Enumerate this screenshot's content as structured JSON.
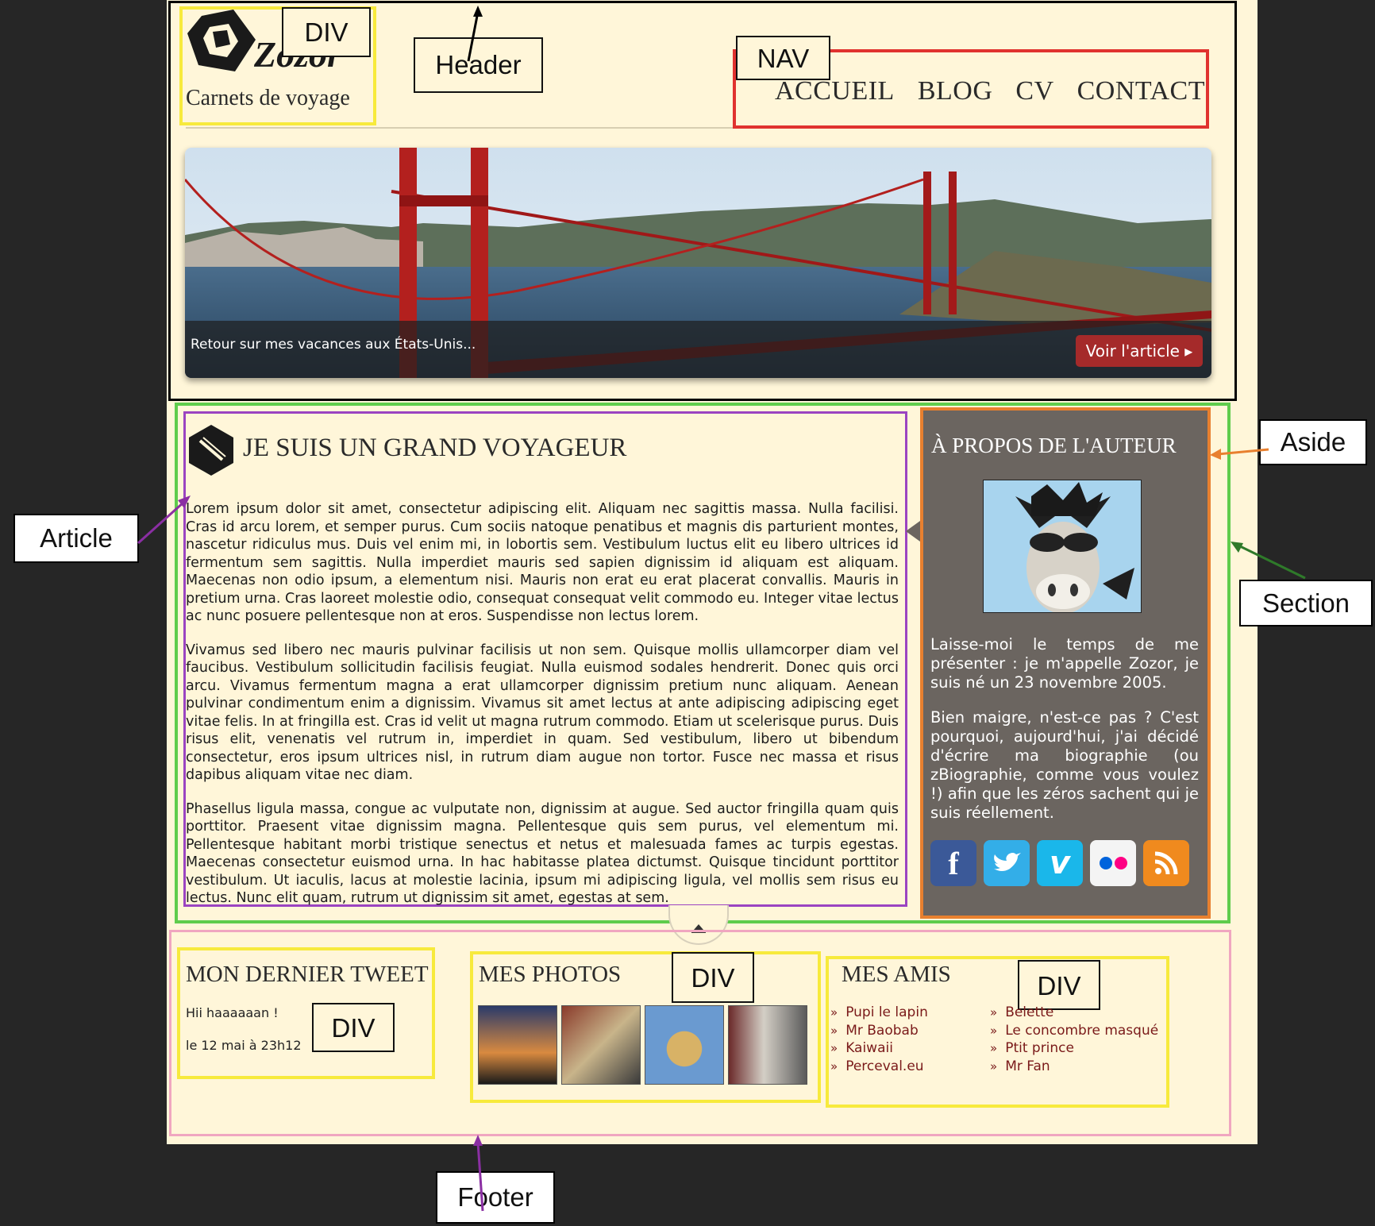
{
  "logo": {
    "name": "Zozor",
    "tagline": "Carnets de voyage"
  },
  "nav": {
    "items": [
      "ACCUEIL",
      "BLOG",
      "CV",
      "CONTACT"
    ]
  },
  "banner": {
    "caption": "Retour sur mes vacances aux États-Unis...",
    "button": "Voir l'article ▸"
  },
  "article": {
    "title": "JE SUIS UN GRAND VOYAGEUR",
    "paragraphs": [
      "Lorem ipsum dolor sit amet, consectetur adipiscing elit. Aliquam nec sagittis massa. Nulla facilisi. Cras id arcu lorem, et semper purus. Cum sociis natoque penatibus et magnis dis parturient montes, nascetur ridiculus mus. Duis vel enim mi, in lobortis sem. Vestibulum luctus elit eu libero ultrices id fermentum sem sagittis. Nulla imperdiet mauris sed sapien dignissim id aliquam est aliquam. Maecenas non odio ipsum, a elementum nisi. Mauris non erat eu erat placerat convallis. Mauris in pretium urna. Cras laoreet molestie odio, consequat consequat velit commodo eu. Integer vitae lectus ac nunc posuere pellentesque non at eros. Suspendisse non lectus lorem.",
      "Vivamus sed libero nec mauris pulvinar facilisis ut non sem. Quisque mollis ullamcorper diam vel faucibus. Vestibulum sollicitudin facilisis feugiat. Nulla euismod sodales hendrerit. Donec quis orci arcu. Vivamus fermentum magna a erat ullamcorper dignissim pretium nunc aliquam. Aenean pulvinar condimentum enim a dignissim. Vivamus sit amet lectus at ante adipiscing adipiscing eget vitae felis. In at fringilla est. Cras id velit ut magna rutrum commodo. Etiam ut scelerisque purus. Duis risus elit, venenatis vel rutrum in, imperdiet in quam. Sed vestibulum, libero ut bibendum consectetur, eros ipsum ultrices nisl, in rutrum diam augue non tortor. Fusce nec massa et risus dapibus aliquam vitae nec diam.",
      "Phasellus ligula massa, congue ac vulputate non, dignissim at augue. Sed auctor fringilla quam quis porttitor. Praesent vitae dignissim magna. Pellentesque quis sem purus, vel elementum mi. Pellentesque habitant morbi tristique senectus et netus et malesuada fames ac turpis egestas. Maecenas consectetur euismod urna. In hac habitasse platea dictumst. Quisque tincidunt porttitor vestibulum. Ut iaculis, lacus at molestie lacinia, ipsum mi adipiscing ligula, vel mollis sem risus eu lectus. Nunc elit quam, rutrum ut dignissim sit amet, egestas at sem."
    ]
  },
  "aside": {
    "title": "À PROPOS DE L'AUTEUR",
    "paragraphs": [
      "Laisse-moi le temps de me présenter : je m'appelle Zozor, je suis né un 23 novembre 2005.",
      "Bien maigre, n'est-ce pas ? C'est pourquoi, aujourd'hui, j'ai décidé d'écrire ma biographie (ou zBiographie, comme vous voulez !) afin que les zéros sachent qui je suis réellement."
    ],
    "social": [
      {
        "icon": "facebook-icon",
        "glyph": "f",
        "color": "#3b5998"
      },
      {
        "icon": "twitter-icon",
        "glyph": "t",
        "color": "#33aee8"
      },
      {
        "icon": "vimeo-icon",
        "glyph": "v",
        "color": "#1ab7ea"
      },
      {
        "icon": "flickr-icon",
        "glyph": "••",
        "color": "#f4f4f4"
      },
      {
        "icon": "rss-icon",
        "glyph": "rss",
        "color": "#f08a1e"
      }
    ]
  },
  "footer": {
    "tweet": {
      "title": "MON DERNIER TWEET",
      "text": "Hii haaaaaan !",
      "date": "le 12 mai à 23h12"
    },
    "photos": {
      "title": "MES PHOTOS"
    },
    "friends": {
      "title": "MES AMIS",
      "col1": [
        "Pupi le lapin",
        "Mr Baobab",
        "Kaiwaii",
        "Perceval.eu"
      ],
      "col2": [
        "Belette",
        "Le concombre masqué",
        "Ptit prince",
        "Mr Fan"
      ]
    }
  },
  "labels": {
    "div": "DIV",
    "header": "Header",
    "nav": "NAV",
    "aside": "Aside",
    "section": "Section",
    "article": "Article",
    "footer": "Footer"
  },
  "colors": {
    "background": "#262626",
    "page": "#fff6d9",
    "header_outline": "#000000",
    "div_outline": "#f7ea3c",
    "nav_outline": "#e0322f",
    "section_outline": "#5fcc4c",
    "article_outline": "#9b44c1",
    "aside_outline": "#e8802f",
    "footer_outline": "#f0a6c0",
    "aside_bg": "#6b6560",
    "button_bg": "#a52a2a"
  }
}
